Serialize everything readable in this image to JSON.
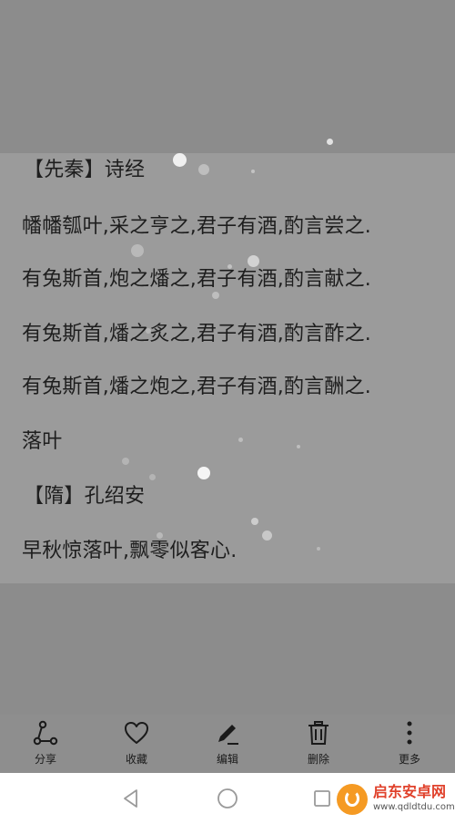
{
  "note": {
    "lines": [
      "【先秦】诗经",
      "幡幡瓠叶,采之亨之,君子有酒,酌言尝之.",
      "有兔斯首,炮之燔之,君子有酒,酌言献之.",
      "有兔斯首,燔之炙之,君子有酒,酌言酢之.",
      "有兔斯首,燔之炮之,君子有酒,酌言酬之.",
      "落叶",
      "【隋】孔绍安",
      "早秋惊落叶,飘零似客心."
    ]
  },
  "toolbar": {
    "share_label": "分享",
    "favorite_label": "收藏",
    "edit_label": "编辑",
    "delete_label": "删除",
    "more_label": "更多",
    "icons": {
      "share": "share-icon",
      "favorite": "heart-icon",
      "edit": "pencil-icon",
      "delete": "trash-icon",
      "more": "more-vertical-icon"
    }
  },
  "navbar": {
    "icons": {
      "back": "back-triangle-icon",
      "home": "home-circle-icon",
      "recent": "recent-square-icon"
    }
  },
  "watermark": {
    "title": "启东安卓网",
    "url": "www.qdldtdu.com"
  },
  "colors": {
    "card_background": "#9b9b9b",
    "screen_dim": "#8c8c8c",
    "text": "#1e1e1e",
    "watermark_orange": "#f59a23",
    "watermark_red": "#e0412b"
  }
}
